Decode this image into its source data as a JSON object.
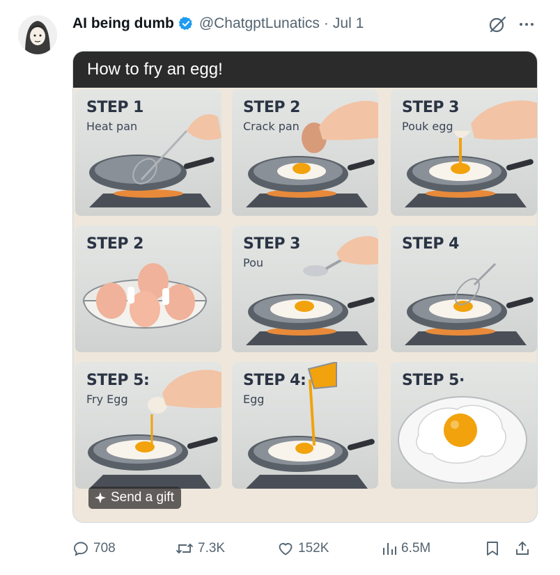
{
  "author": {
    "display_name": "AI being dumb",
    "handle": "@ChatgptLunatics",
    "separator": "·",
    "date": "Jul 1"
  },
  "media": {
    "title": "How to fry an egg!",
    "panels": [
      {
        "step": "STEP 1",
        "sub": "Heat pan"
      },
      {
        "step": "STEP 2",
        "sub": "Crack pan"
      },
      {
        "step": "STEP 3",
        "sub": "Pouk egg"
      },
      {
        "step": "STEP 2",
        "sub": ""
      },
      {
        "step": "STEP 3",
        "sub": "Pou"
      },
      {
        "step": "STEP 4",
        "sub": ""
      },
      {
        "step": "STEP 5:",
        "sub": "Fry Egg"
      },
      {
        "step": "STEP 4:",
        "sub": "Egg"
      },
      {
        "step": "STEP 5·",
        "sub": ""
      }
    ],
    "gift_label": "Send a gift"
  },
  "actions": {
    "replies": "708",
    "reposts": "7.3K",
    "likes": "152K",
    "views": "6.5M"
  },
  "colors": {
    "verified": "#1d9bf0",
    "muted_text": "#536471",
    "yolk": "#f2a20c"
  }
}
